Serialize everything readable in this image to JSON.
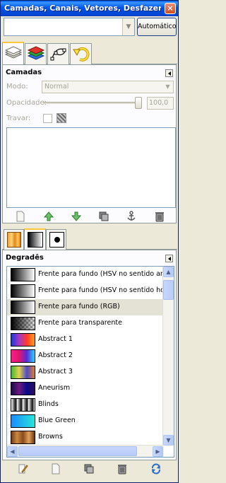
{
  "window": {
    "title": "Camadas, Canais, Vetores, Desfazer - T...",
    "close_glyph": "×"
  },
  "image_selector": {
    "value": "",
    "auto_button": "Automático"
  },
  "tabs": [
    {
      "name": "layers-tab",
      "icon": "layers-icon"
    },
    {
      "name": "channels-tab",
      "icon": "channels-icon"
    },
    {
      "name": "paths-tab",
      "icon": "paths-icon"
    },
    {
      "name": "undo-tab",
      "icon": "undo-icon"
    }
  ],
  "layers_panel": {
    "title": "Camadas",
    "mode_label": "Modo:",
    "mode_value": "Normal",
    "opacity_label": "Opacidade:",
    "opacity_value": "100,0",
    "opacity_fraction": 1.0,
    "lock_label": "Travar:",
    "buttons": [
      "new-layer-icon",
      "raise-layer-icon",
      "lower-layer-icon",
      "duplicate-layer-icon",
      "anchor-layer-icon",
      "delete-layer-icon"
    ]
  },
  "lower_tabs": [
    {
      "name": "patterns-tab"
    },
    {
      "name": "gradients-tab"
    },
    {
      "name": "brushes-tab"
    }
  ],
  "gradients_panel": {
    "title": "Degradês",
    "items": [
      {
        "label": "Frente para fundo (HSV no sentido anti-horário)",
        "swatch": "linear-gradient(90deg,#000,#fff)"
      },
      {
        "label": "Frente para fundo (HSV no sentido horário)",
        "swatch": "linear-gradient(90deg,#000,#fff)"
      },
      {
        "label": "Frente para fundo (RGB)",
        "swatch": "linear-gradient(90deg,#000,#fff)"
      },
      {
        "label": "Frente para transparente",
        "swatch": "linear-gradient(90deg,#000,rgba(0,0,0,0)),repeating-conic-gradient(#999 0 25%,#ddd 0 50%) 0 0/6px 6px"
      },
      {
        "label": "Abstract 1",
        "swatch": "linear-gradient(90deg,#1d3bd6,#a537c8,#ff3a2a,#ff9b1a)"
      },
      {
        "label": "Abstract 2",
        "swatch": "linear-gradient(90deg,#ff1c8a,#e0186f,#5a2ad8,#23d5ff)"
      },
      {
        "label": "Abstract 3",
        "swatch": "linear-gradient(90deg,#3fb83a,#e6d24a,#4f4cc6,#e07d2b)"
      },
      {
        "label": "Aneurism",
        "swatch": "linear-gradient(90deg,#1a0a4c,#6b1a7d,#0a0a8a,#2e0d5a)"
      },
      {
        "label": "Blinds",
        "swatch": "repeating-linear-gradient(90deg,#fff 0,#888 3px,#111 6px,#888 8px)"
      },
      {
        "label": "Blue Green",
        "swatch": "linear-gradient(90deg,#1c8cff,#25e6d8)"
      },
      {
        "label": "Browns",
        "swatch": "linear-gradient(90deg,#7a3a12,#c98a45,#8a4a1c,#e0a25a,#6e3410)"
      }
    ],
    "buttons": [
      "edit-gradient-icon",
      "new-gradient-icon",
      "duplicate-gradient-icon",
      "delete-gradient-icon",
      "refresh-gradients-icon"
    ]
  }
}
